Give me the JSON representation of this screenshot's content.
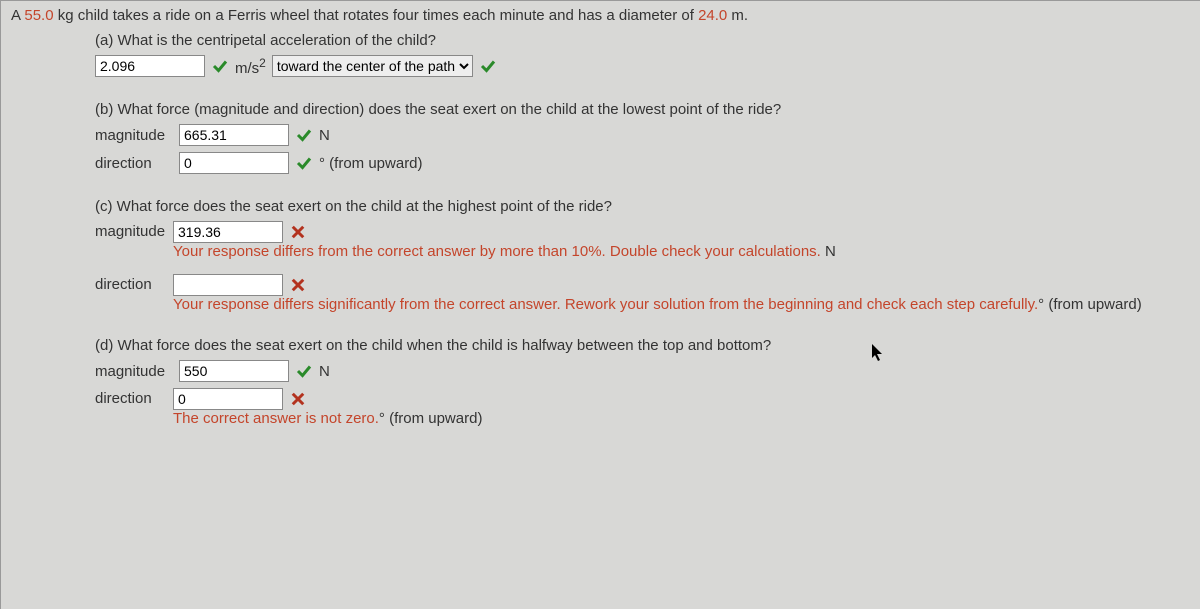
{
  "intro": {
    "prefix": "A ",
    "mass": "55.0",
    "middle": " kg child takes a ride on a Ferris wheel that rotates four times each minute and has a diameter of ",
    "diameter": "24.0",
    "suffix": " m."
  },
  "a": {
    "prompt": "(a) What is the centripetal acceleration of the child?",
    "value": "2.096",
    "unit_html": "m/s",
    "unit_sup": "2",
    "select": "toward the center of the path"
  },
  "b": {
    "prompt": "(b) What force (magnitude and direction) does the seat exert on the child at the lowest point of the ride?",
    "mag_label": "magnitude",
    "mag_value": "665.31",
    "mag_unit": "N",
    "dir_label": "direction",
    "dir_value": "0",
    "dir_unit": "° (from upward)"
  },
  "c": {
    "prompt": "(c) What force does the seat exert on the child at the highest point of the ride?",
    "mag_label": "magnitude",
    "mag_value": "319.36",
    "mag_feedback": "Your response differs from the correct answer by more than 10%. Double check your calculations.",
    "mag_unit": " N",
    "dir_label": "direction",
    "dir_value": "",
    "dir_feedback": "Your response differs significantly from the correct answer. Rework your solution from the beginning and check each step carefully.",
    "dir_unit": "° (from upward)"
  },
  "d": {
    "prompt": "(d) What force does the seat exert on the child when the child is halfway between the top and bottom?",
    "mag_label": "magnitude",
    "mag_value": "550",
    "mag_unit": "N",
    "dir_label": "direction",
    "dir_value": "0",
    "dir_feedback": "The correct answer is not zero.",
    "dir_unit": "° (from upward)"
  }
}
